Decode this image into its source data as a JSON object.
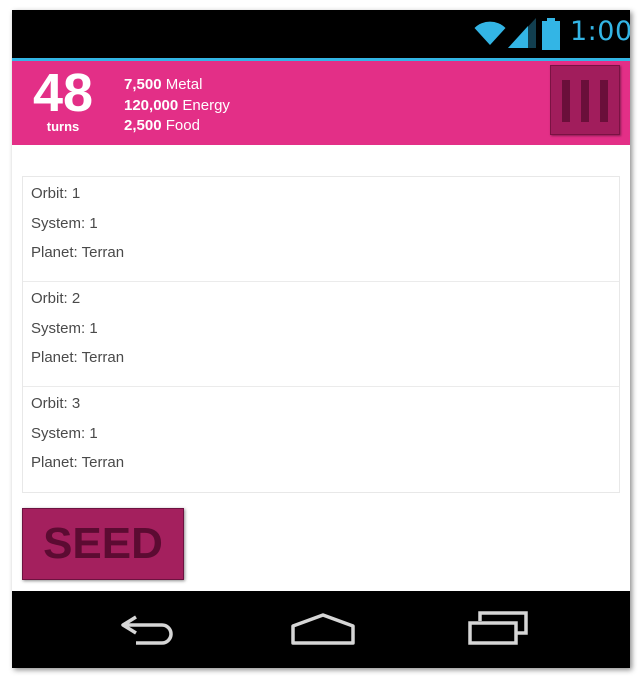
{
  "status_bar": {
    "time": "1:00",
    "icons": [
      "wifi-icon",
      "signal-icon",
      "battery-icon"
    ]
  },
  "header": {
    "turns_count": "48",
    "turns_label": "turns",
    "resources": [
      {
        "amount": "7,500",
        "name": "Metal"
      },
      {
        "amount": "120,000",
        "name": "Energy"
      },
      {
        "amount": "2,500",
        "name": "Food"
      }
    ],
    "menu_icon": "menu-bars-icon"
  },
  "planets": [
    {
      "orbit": "Orbit: 1",
      "system": "System: 1",
      "planet": "Planet: Terran"
    },
    {
      "orbit": "Orbit: 2",
      "system": "System: 1",
      "planet": "Planet: Terran"
    },
    {
      "orbit": "Orbit: 3",
      "system": "System: 1",
      "planet": "Planet: Terran"
    }
  ],
  "seed_button_label": "SEED",
  "nav_bar": {
    "icons": [
      "back-icon",
      "home-icon",
      "recent-apps-icon"
    ]
  },
  "colors": {
    "accent": "#33b5e5",
    "header_bg": "#e32f87",
    "button_bg": "#a4205e",
    "button_text": "#5c0b32"
  }
}
